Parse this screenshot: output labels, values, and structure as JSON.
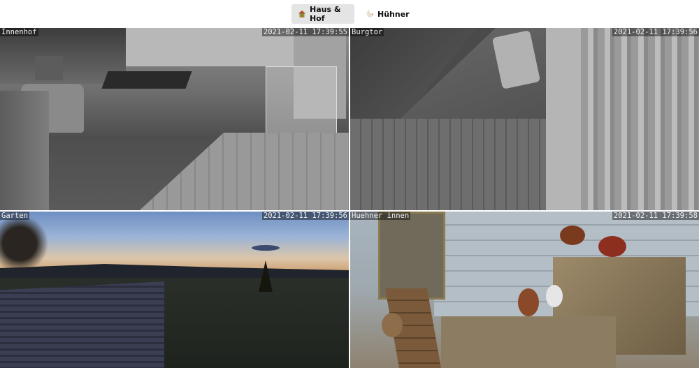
{
  "tabs": [
    {
      "label": "Haus & Hof",
      "icon": "house-icon",
      "active": true
    },
    {
      "label": "Hühner",
      "icon": "chicken-icon",
      "active": false
    }
  ],
  "cameras": [
    {
      "label": "Innenhof",
      "timestamp": "2021-02-11 17:39:55"
    },
    {
      "label": "Burgtor",
      "timestamp": "2021-02-11 17:39:56"
    },
    {
      "label": "Garten",
      "timestamp": "2021-02-11 17:39:56"
    },
    {
      "label": "Huehner innen",
      "timestamp": "2021-02-11 17:39:58"
    }
  ],
  "colors": {
    "active_tab_bg": "#e4e4e4",
    "overlay_text": "#f2f2f2"
  }
}
